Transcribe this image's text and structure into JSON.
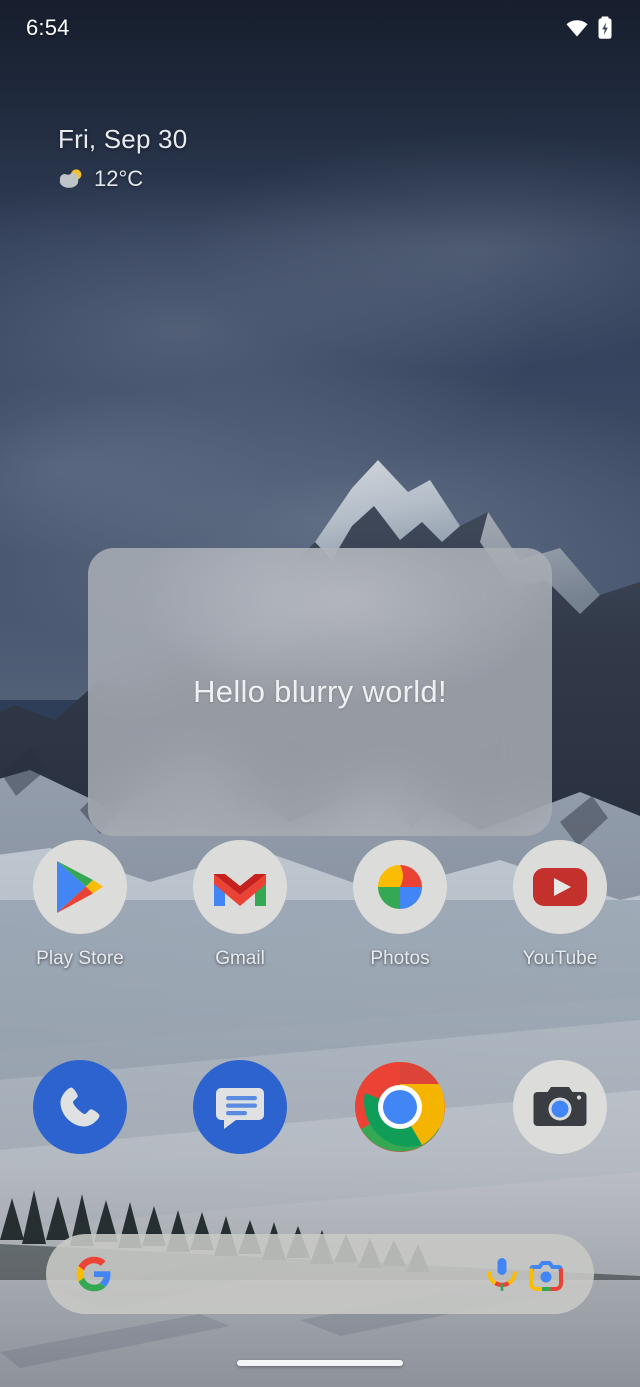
{
  "status_bar": {
    "clock": "6:54",
    "icons": [
      {
        "name": "wifi-icon",
        "label": "Wi-Fi"
      },
      {
        "name": "battery-charging-icon",
        "label": "Battery charging"
      }
    ]
  },
  "smartspace": {
    "date": "Fri, Sep 30",
    "temperature": "12°C",
    "weather_icon": "partly-cloudy-icon"
  },
  "blur_card": {
    "text": "Hello blurry world!"
  },
  "app_grid": {
    "apps": [
      {
        "label": "Play Store",
        "icon": "play-store-icon"
      },
      {
        "label": "Gmail",
        "icon": "gmail-icon"
      },
      {
        "label": "Photos",
        "icon": "google-photos-icon"
      },
      {
        "label": "YouTube",
        "icon": "youtube-icon"
      }
    ]
  },
  "dock": {
    "apps": [
      {
        "label": "Phone",
        "icon": "phone-icon"
      },
      {
        "label": "Messages",
        "icon": "messages-icon"
      },
      {
        "label": "Chrome",
        "icon": "chrome-icon"
      },
      {
        "label": "Camera",
        "icon": "camera-icon"
      }
    ]
  },
  "search": {
    "placeholder": "",
    "value": "",
    "google_logo": "google-g-icon",
    "mic_icon": "microphone-icon",
    "lens_icon": "google-lens-icon"
  },
  "navigation": {
    "home_pill": "home-gesture-pill"
  },
  "colors": {
    "google_blue": "#4285F4",
    "google_red": "#EA4335",
    "google_yellow": "#FBBC05",
    "google_green": "#34A853",
    "youtube_red": "#C4302B",
    "card_fill": "#B0B4BA",
    "sky": "#32405A"
  }
}
